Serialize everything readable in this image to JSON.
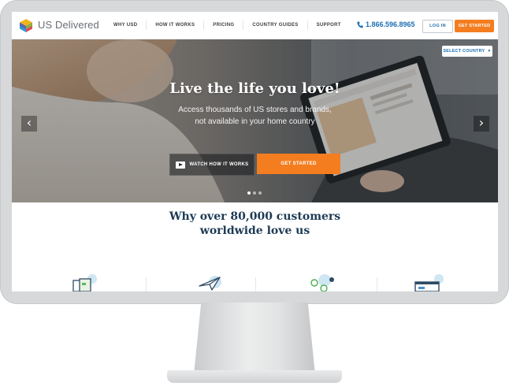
{
  "brand": {
    "name": "US Delivered"
  },
  "nav": {
    "items": [
      {
        "label": "WHY USD"
      },
      {
        "label": "HOW IT WORKS"
      },
      {
        "label": "PRICING"
      },
      {
        "label": "COUNTRY GUIDES"
      },
      {
        "label": "SUPPORT"
      }
    ]
  },
  "header": {
    "phone": "1.866.596.8965",
    "login_label": "LOG IN",
    "get_started_label": "GET STARTED"
  },
  "hero": {
    "select_country_label": "SELECT COUNTRY",
    "title": "Live the life you love!",
    "subtitle": "Access thousands of US stores and brands, not available in your home country",
    "watch_label": "WATCH HOW IT WORKS",
    "get_started_label": "GET STARTED",
    "prev_glyph": "‹",
    "next_glyph": "›"
  },
  "section": {
    "title_line1": "Why over 80,000 customers",
    "title_line2": "worldwide love us"
  },
  "colors": {
    "accent_orange": "#f47d20",
    "brand_blue": "#1c6fb3",
    "heading_navy": "#1d3b55"
  }
}
